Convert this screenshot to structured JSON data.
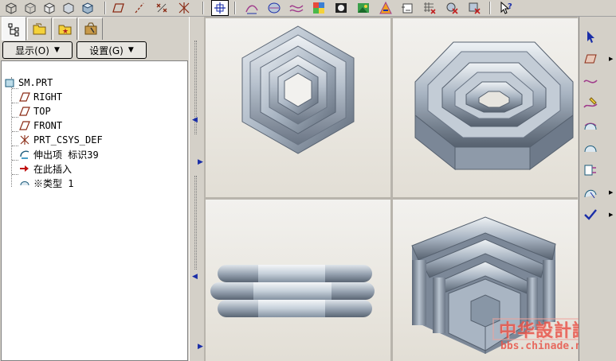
{
  "toolbar": {
    "view_buttons": [
      "view-cube-1-icon",
      "view-cube-2-icon",
      "view-cube-3-icon",
      "view-cube-4-icon"
    ],
    "datum_buttons": [
      "datum-plane-display-icon",
      "datum-axis-display-icon",
      "datum-point-display-icon",
      "csys-display-icon"
    ],
    "active_button": "select-grid-icon"
  },
  "tabs": [
    "model-tree-tab",
    "folder-browser-tab",
    "favorites-tab",
    "tools-tab"
  ],
  "menus": {
    "show_label": "显示(O)",
    "settings_label": "设置(G)"
  },
  "tree": {
    "root": "SM.PRT",
    "items": [
      {
        "label": "RIGHT",
        "icon": "datum-plane-icon"
      },
      {
        "label": "TOP",
        "icon": "datum-plane-icon"
      },
      {
        "label": "FRONT",
        "icon": "datum-plane-icon"
      },
      {
        "label": "PRT_CSYS_DEF",
        "icon": "csys-icon"
      },
      {
        "label": "伸出项 标识39",
        "icon": "protrusion-icon"
      },
      {
        "label": "在此插入",
        "icon": "insert-here-arrow-icon"
      },
      {
        "label": "※类型 1",
        "icon": "surface-type-icon"
      }
    ]
  },
  "watermark": {
    "title": "中华設計論壇",
    "url": "bbs.chinade.net"
  },
  "colors": {
    "model_light": "#c9d2dc",
    "model_mid": "#97a4b3",
    "model_dark": "#5d6877",
    "bg_light": "#f0efeb",
    "accent_blue": "#1a2ea8",
    "watermark_red": "#e8554a"
  }
}
